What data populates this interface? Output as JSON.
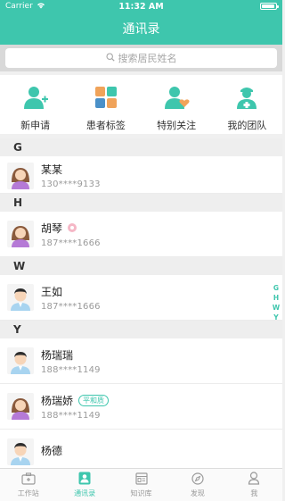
{
  "status_bar": {
    "carrier": "Carrier",
    "time": "11:32 AM",
    "battery_level": 0.9
  },
  "nav": {
    "title": "通讯录"
  },
  "search": {
    "placeholder": "搜索居民姓名"
  },
  "quick_actions": [
    {
      "label": "新申请",
      "icon": "add-user-icon"
    },
    {
      "label": "患者标签",
      "icon": "tag-grid-icon"
    },
    {
      "label": "特别关注",
      "icon": "heart-user-icon"
    },
    {
      "label": "我的团队",
      "icon": "doctor-icon"
    }
  ],
  "sections": [
    {
      "letter": "G",
      "contacts": [
        {
          "name": "某某",
          "phone": "130****9133",
          "gender": "female"
        }
      ]
    },
    {
      "letter": "H",
      "contacts": [
        {
          "name": "胡琴",
          "phone": "187****1666",
          "gender": "female",
          "badge_icon": "pink-dot-icon"
        }
      ]
    },
    {
      "letter": "W",
      "contacts": [
        {
          "name": "王如",
          "phone": "187****1666",
          "gender": "male"
        }
      ]
    },
    {
      "letter": "Y",
      "contacts": [
        {
          "name": "杨瑞瑞",
          "phone": "188****1149",
          "gender": "male"
        },
        {
          "name": "杨瑞娇",
          "phone": "188****1149",
          "gender": "female",
          "tag": "平和质"
        },
        {
          "name": "杨德",
          "phone": "",
          "gender": "male"
        }
      ]
    }
  ],
  "index_letters": [
    "G",
    "H",
    "W",
    "Y"
  ],
  "tabs": [
    {
      "label": "工作站",
      "icon": "workstation-icon",
      "active": false
    },
    {
      "label": "通讯录",
      "icon": "contacts-icon",
      "active": true
    },
    {
      "label": "知识库",
      "icon": "knowledge-icon",
      "active": false
    },
    {
      "label": "发现",
      "icon": "compass-icon",
      "active": false
    },
    {
      "label": "我",
      "icon": "profile-icon",
      "active": false
    }
  ],
  "colors": {
    "accent": "#3ec6ad",
    "tag_pink": "#f5b7c6"
  }
}
